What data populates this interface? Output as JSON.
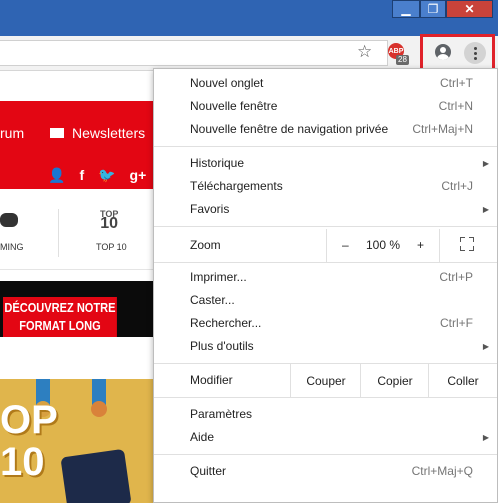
{
  "window": {
    "minimize_icon": "minimize-icon",
    "maximize_icon": "restore-icon",
    "close_icon": "close-icon"
  },
  "toolbar": {
    "extension_label": "ABP",
    "extension_count": "28"
  },
  "page": {
    "forum_label": "rum",
    "newsletters_label": "Newsletters",
    "social_icons": [
      "user-icon",
      "facebook-icon",
      "twitter-icon",
      "google-plus-icon"
    ],
    "social_glyphs": [
      "👤",
      "f",
      "🐦",
      "g+"
    ],
    "nav": {
      "gaming_label": "MING",
      "top10_small": "TOP",
      "top10_big": "10",
      "top10_label": "TOP 10"
    },
    "banner_line1": "DÉCOUVREZ NOTRE",
    "banner_line2": "FORMAT LONG",
    "promo_line1": "OP",
    "promo_line2": "10"
  },
  "menu": {
    "group1": [
      {
        "label": "Nouvel onglet",
        "shortcut": "Ctrl+T"
      },
      {
        "label": "Nouvelle fenêtre",
        "shortcut": "Ctrl+N"
      },
      {
        "label": "Nouvelle fenêtre de navigation privée",
        "shortcut": "Ctrl+Maj+N"
      }
    ],
    "group2": [
      {
        "label": "Historique",
        "shortcut": ""
      },
      {
        "label": "Téléchargements",
        "shortcut": "Ctrl+J"
      },
      {
        "label": "Favoris",
        "shortcut": ""
      }
    ],
    "zoom": {
      "label": "Zoom",
      "minus": "–",
      "value": "100 %",
      "plus": "+"
    },
    "group3": [
      {
        "label": "Imprimer...",
        "shortcut": "Ctrl+P"
      },
      {
        "label": "Caster...",
        "shortcut": ""
      },
      {
        "label": "Rechercher...",
        "shortcut": "Ctrl+F"
      },
      {
        "label": "Plus d'outils",
        "shortcut": ""
      }
    ],
    "edit": {
      "label": "Modifier",
      "cut": "Couper",
      "copy": "Copier",
      "paste": "Coller"
    },
    "group4": [
      {
        "label": "Paramètres",
        "shortcut": ""
      },
      {
        "label": "Aide",
        "shortcut": ""
      }
    ],
    "quit": {
      "label": "Quitter",
      "shortcut": "Ctrl+Maj+Q"
    }
  },
  "colors": {
    "titlebar": "#2f64b3",
    "brand_red": "#e30613",
    "highlight": "#e0222a"
  }
}
